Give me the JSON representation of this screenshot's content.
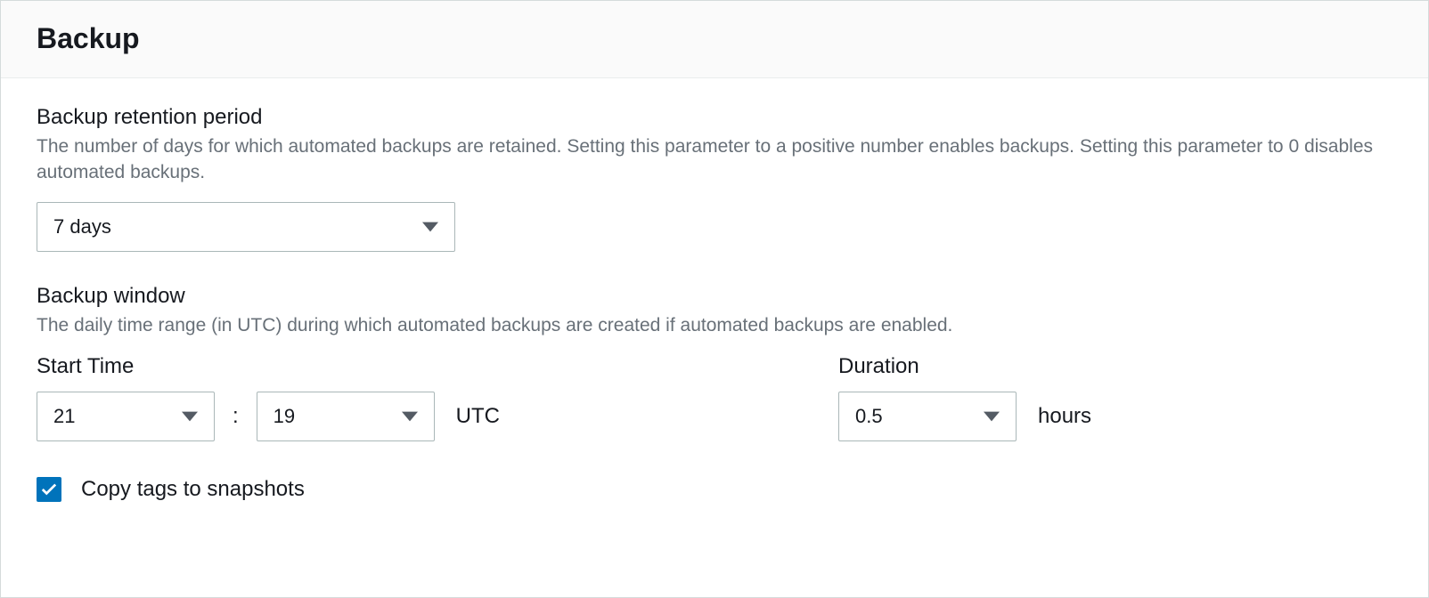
{
  "panel": {
    "title": "Backup"
  },
  "retention": {
    "label": "Backup retention period",
    "description": "The number of days for which automated backups are retained. Setting this parameter to a positive number enables backups. Setting this parameter to 0 disables automated backups.",
    "value": "7 days"
  },
  "window": {
    "label": "Backup window",
    "description": "The daily time range (in UTC) during which automated backups are created if automated backups are enabled.",
    "start_time_label": "Start Time",
    "duration_label": "Duration",
    "start_hour": "21",
    "start_minute": "19",
    "tz": "UTC",
    "duration_value": "0.5",
    "duration_unit": "hours",
    "colon": ":"
  },
  "copy_tags": {
    "checked": true,
    "label": "Copy tags to snapshots"
  }
}
